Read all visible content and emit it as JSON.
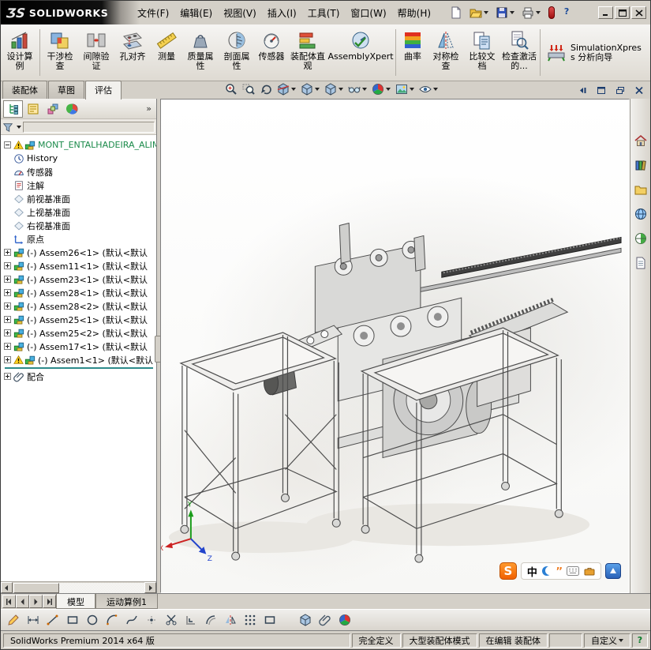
{
  "titlebar": {
    "logo_mark": "ƷS",
    "brand": "SOLIDWORKS"
  },
  "menubar": {
    "items": [
      "文件(F)",
      "编辑(E)",
      "视图(V)",
      "插入(I)",
      "工具(T)",
      "窗口(W)",
      "帮助(H)"
    ]
  },
  "ribbon": {
    "buttons": [
      {
        "label": "设计算例"
      },
      {
        "label": "干涉检查"
      },
      {
        "label": "间隙验证"
      },
      {
        "label": "孔对齐"
      },
      {
        "label": "测量"
      },
      {
        "label": "质量属性"
      },
      {
        "label": "剖面属性"
      },
      {
        "label": "传感器"
      },
      {
        "label": "装配体直观"
      },
      {
        "label": "AssemblyXpert"
      },
      {
        "label": "曲率"
      },
      {
        "label": "对称检查"
      },
      {
        "label": "比较文档"
      },
      {
        "label": "检查激活的..."
      },
      {
        "label": "SimulationXpress 分析向导"
      }
    ]
  },
  "command_tabs": [
    {
      "label": "装配体",
      "active": false
    },
    {
      "label": "草图",
      "active": false
    },
    {
      "label": "评估",
      "active": true
    }
  ],
  "feature_tree": {
    "root_label": "MONT_ENTALHADEIRA_ALIMENTA",
    "items": [
      {
        "label": "History"
      },
      {
        "label": "传感器"
      },
      {
        "label": "注解"
      },
      {
        "label": "前视基准面"
      },
      {
        "label": "上视基准面"
      },
      {
        "label": "右视基准面"
      },
      {
        "label": "原点"
      },
      {
        "label": "(-) Assem26<1> (默认<默认"
      },
      {
        "label": "(-) Assem11<1> (默认<默认"
      },
      {
        "label": "(-) Assem23<1> (默认<默认"
      },
      {
        "label": "(-) Assem28<1> (默认<默认"
      },
      {
        "label": "(-) Assem28<2> (默认<默认"
      },
      {
        "label": "(-) Assem25<1> (默认<默认"
      },
      {
        "label": "(-) Assem25<2> (默认<默认"
      },
      {
        "label": "(-) Assem17<1> (默认<默认"
      },
      {
        "label": "(-) Assem1<1> (默认<默认"
      },
      {
        "label": "配合"
      }
    ]
  },
  "doc_tabs": [
    {
      "label": "模型",
      "active": true
    },
    {
      "label": "运动算例1",
      "active": false
    }
  ],
  "statusbar": {
    "version": "SolidWorks Premium 2014 x64 版",
    "fully_defined": "完全定义",
    "large_assembly_mode": "大型装配体模式",
    "editing": "在编辑 装配体",
    "customize": "自定义"
  },
  "ime": {
    "lang": "中"
  },
  "icons": {
    "titlebar": [
      "new-document-icon",
      "open-document-icon",
      "save-icon",
      "print-icon",
      "performance-indicator-icon",
      "help-icon"
    ],
    "view_toolbar": [
      "zoom-fit-icon",
      "zoom-area-icon",
      "previous-view-icon",
      "section-view-icon",
      "view-orientation-icon",
      "display-style-icon",
      "hide-show-items-icon",
      "edit-appearance-icon",
      "apply-scene-icon",
      "view-settings-icon"
    ],
    "taskpane": [
      "resources-home-icon",
      "design-library-icon",
      "file-explorer-icon",
      "forum-globe-icon",
      "appearances-icon",
      "custom-properties-icon"
    ],
    "fm_tabs": [
      "feature-tree-icon",
      "property-manager-icon",
      "configuration-manager-icon",
      "display-manager-icon"
    ],
    "bottom_toolbar": [
      "sketch-pencil-icon",
      "smart-dimension-icon",
      "line-icon",
      "rectangle-icon",
      "circle-icon",
      "arc-icon",
      "spline-icon",
      "point-icon",
      "trim-icon",
      "convert-entities-icon",
      "offset-entities-icon",
      "mirror-entities-icon",
      "pattern-icon",
      "insert-component-icon",
      "mate-icon",
      "appearance-ball-icon",
      "section-icon"
    ]
  }
}
